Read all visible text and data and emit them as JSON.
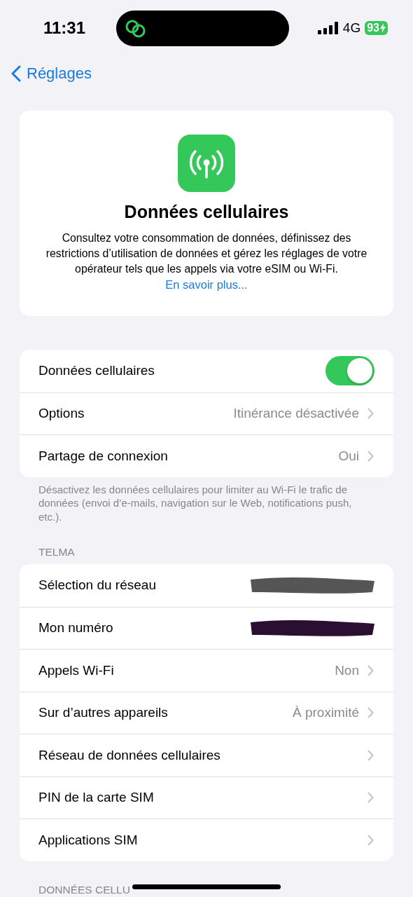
{
  "status_bar": {
    "time": "11:31",
    "network": "4G",
    "battery": "93",
    "charging": true
  },
  "nav": {
    "back": "Réglages"
  },
  "header_card": {
    "title": "Données cellulaires",
    "description": "Consultez votre consommation de données, définissez des restrictions d’utilisation de données et gérez les réglages de votre opérateur tels que les appels via votre eSIM ou Wi-Fi.",
    "link": "En savoir plus..."
  },
  "groups": [
    {
      "rows": [
        {
          "kind": "toggle",
          "label": "Données cellulaires",
          "on": true
        },
        {
          "kind": "link",
          "label": "Options",
          "value": "Itinérance désactivée"
        },
        {
          "kind": "link",
          "label": "Partage de connexion",
          "value": "Oui"
        }
      ],
      "footer": "Désactivez les données cellulaires pour limiter au Wi-Fi le trafic de données (envoi d’e-mails, navigation sur le Web, notifications push, etc.)."
    },
    {
      "header": "TELMA",
      "rows": [
        {
          "kind": "redacted",
          "label": "Sélection du réseau",
          "color": "#555555"
        },
        {
          "kind": "redacted",
          "label": "Mon numéro",
          "color": "#2a0f33"
        },
        {
          "kind": "link",
          "label": "Appels Wi-Fi",
          "value": "Non"
        },
        {
          "kind": "link",
          "label": "Sur d’autres appareils",
          "value": "À proximité"
        },
        {
          "kind": "link",
          "label": "Réseau de données cellulaires"
        },
        {
          "kind": "link",
          "label": "PIN de la carte SIM"
        },
        {
          "kind": "link",
          "label": "Applications SIM"
        }
      ]
    },
    {
      "header": "DONNÉES CELLU"
    }
  ]
}
